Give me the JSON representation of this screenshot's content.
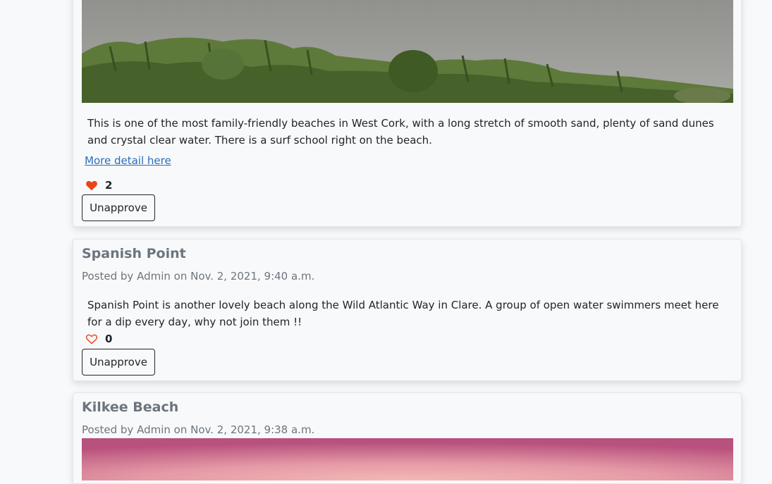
{
  "posts": [
    {
      "excerpt": "This is one of the most family-friendly beaches in West Cork, with a long stretch of smooth sand, plenty of sand dunes and crystal clear water. There is a surf school right on the beach.",
      "more_link": "More detail here",
      "likes": "2",
      "liked": true,
      "button": "Unapprove"
    },
    {
      "title": "Spanish Point",
      "meta": "Posted by Admin on Nov. 2, 2021, 9:40 a.m.",
      "excerpt": "Spanish Point is another lovely beach along the Wild Atlantic Way in Clare. A group of open water swimmers meet here for a dip every day, why not join them !!",
      "likes": "0",
      "liked": false,
      "button": "Unapprove"
    },
    {
      "title": "Kilkee Beach",
      "meta": "Posted by Admin on Nov. 2, 2021, 9:38 a.m."
    }
  ],
  "icons": {
    "liked": "heart-filled-icon",
    "not_liked": "heart-outline-icon"
  },
  "colors": {
    "heart": "#e8451d",
    "link": "#2a6ebd",
    "title": "#6c757d"
  }
}
